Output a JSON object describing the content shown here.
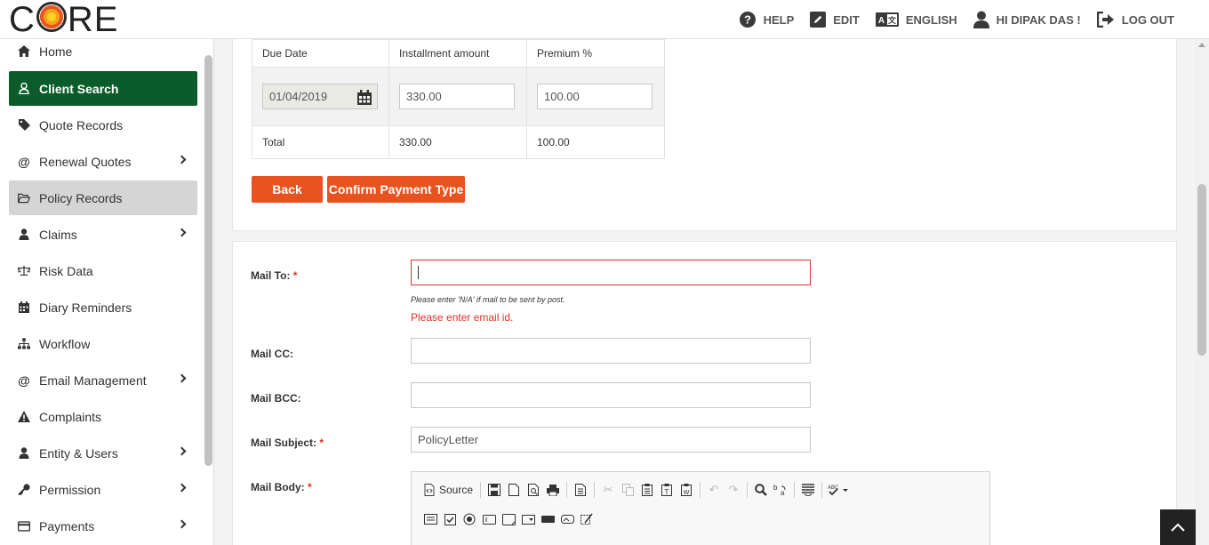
{
  "brand": {
    "logo_text_pre": "C",
    "logo_text_post": "RE"
  },
  "topnav": [
    {
      "label": "HELP",
      "icon": "help-circle-icon"
    },
    {
      "label": "EDIT",
      "icon": "edit-icon"
    },
    {
      "label": "ENGLISH",
      "icon": "translate-icon"
    },
    {
      "label": "HI DIPAK DAS !",
      "icon": "user-icon"
    },
    {
      "label": "LOG OUT",
      "icon": "logout-icon"
    }
  ],
  "sidebar": {
    "items": [
      {
        "label": "Home",
        "icon": "home-icon",
        "has_children": false,
        "state": "normal"
      },
      {
        "label": "Client Search",
        "icon": "user-outline-icon",
        "has_children": false,
        "state": "active"
      },
      {
        "label": "Quote Records",
        "icon": "tag-icon",
        "has_children": false,
        "state": "normal"
      },
      {
        "label": "Renewal Quotes",
        "icon": "at-icon",
        "has_children": true,
        "state": "normal"
      },
      {
        "label": "Policy Records",
        "icon": "folder-open-icon",
        "has_children": false,
        "state": "selected"
      },
      {
        "label": "Claims",
        "icon": "user-icon",
        "has_children": true,
        "state": "normal"
      },
      {
        "label": "Risk Data",
        "icon": "balance-scale-icon",
        "has_children": false,
        "state": "normal"
      },
      {
        "label": "Diary Reminders",
        "icon": "calendar-icon",
        "has_children": false,
        "state": "normal"
      },
      {
        "label": "Workflow",
        "icon": "sitemap-icon",
        "has_children": false,
        "state": "normal"
      },
      {
        "label": "Email Management",
        "icon": "at-icon",
        "has_children": true,
        "state": "normal"
      },
      {
        "label": "Complaints",
        "icon": "warning-icon",
        "has_children": false,
        "state": "normal"
      },
      {
        "label": "Entity & Users",
        "icon": "user-icon",
        "has_children": true,
        "state": "normal"
      },
      {
        "label": "Permission",
        "icon": "key-icon",
        "has_children": true,
        "state": "normal"
      },
      {
        "label": "Payments",
        "icon": "credit-card-icon",
        "has_children": true,
        "state": "normal"
      }
    ]
  },
  "installments": {
    "headers": [
      "Due Date",
      "Installment amount",
      "Premium %"
    ],
    "row": {
      "due_date": "01/04/2019",
      "amount": "330.00",
      "premium": "100.00"
    },
    "total": {
      "label": "Total",
      "amount": "330.00",
      "premium": "100.00"
    }
  },
  "actions": {
    "back": "Back",
    "confirm": "Confirm Payment Type"
  },
  "mail": {
    "to_label": "Mail To:",
    "to_value": "",
    "to_hint": "Please enter 'N/A' if mail to be sent by post.",
    "to_error": "Please enter email id.",
    "cc_label": "Mail CC:",
    "cc_value": "",
    "bcc_label": "Mail BCC:",
    "bcc_value": "",
    "subject_label": "Mail Subject:",
    "subject_value": "PolicyLetter",
    "body_label": "Mail Body:",
    "required_mark": "*"
  },
  "editor": {
    "source_label": "Source"
  },
  "colors": {
    "accent": "#e8521f",
    "sidebar_active": "#0b5c2a",
    "error": "#d9342b"
  }
}
